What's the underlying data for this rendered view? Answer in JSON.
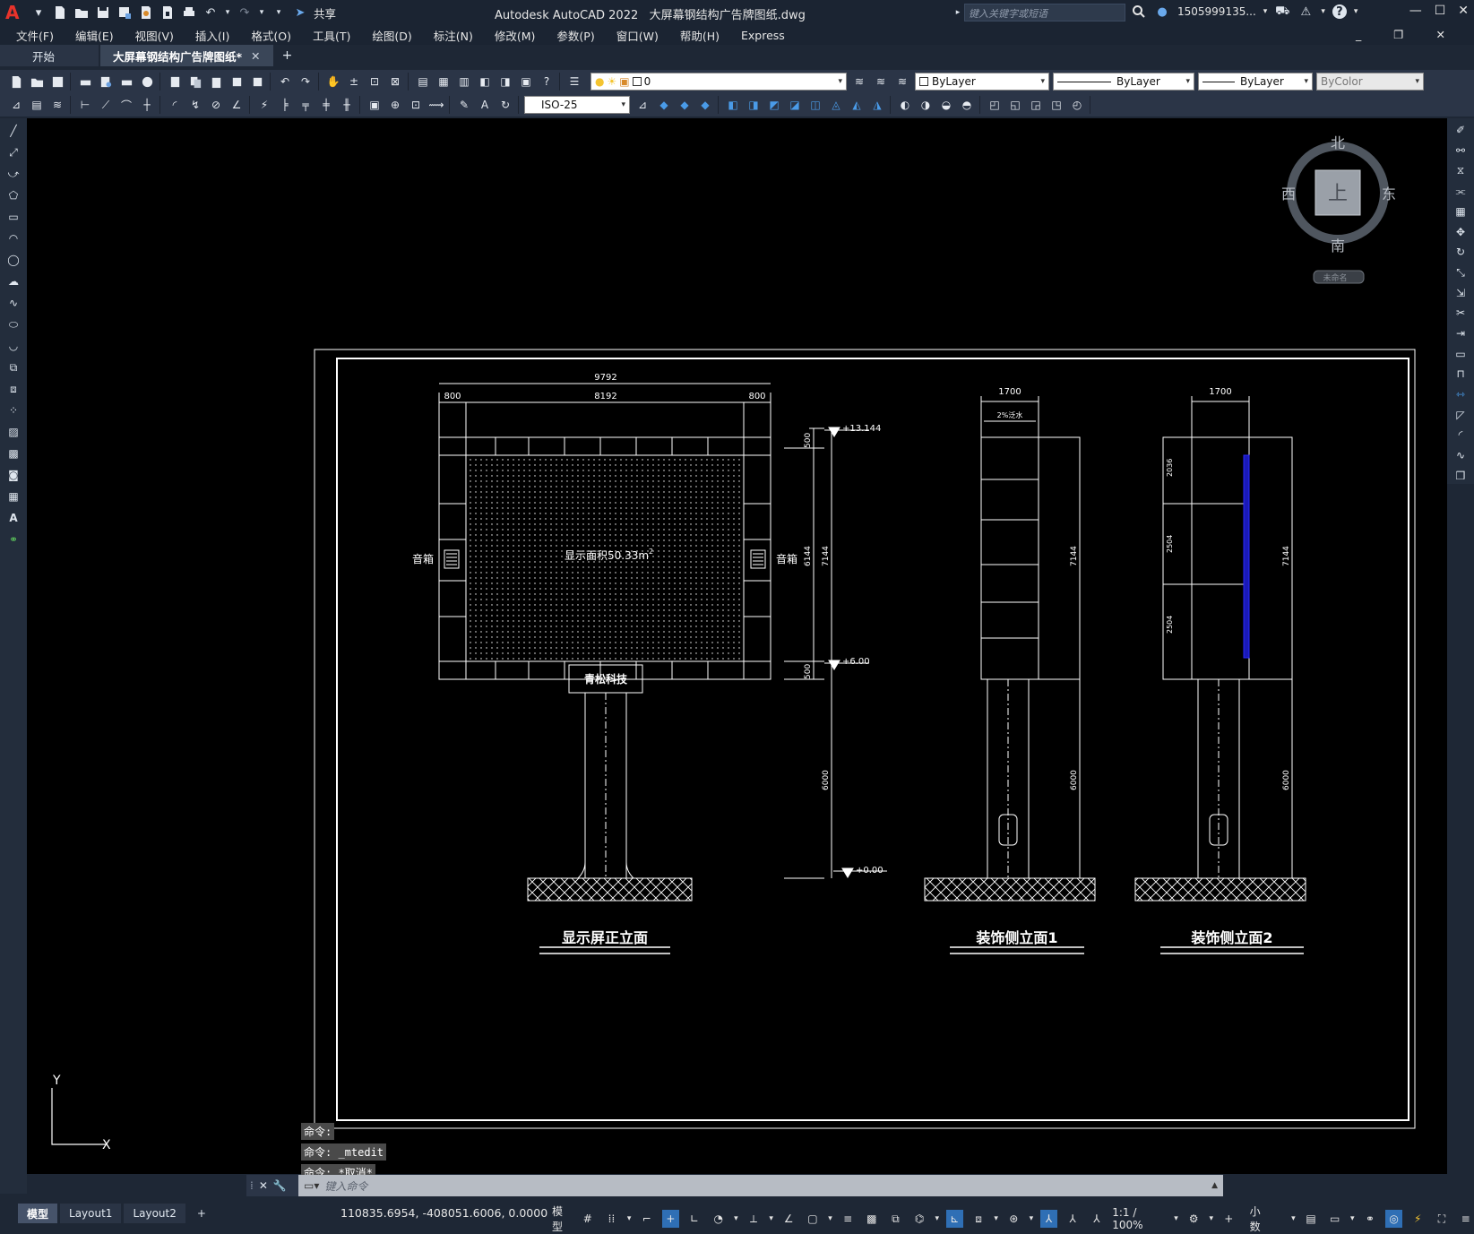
{
  "app": {
    "title": "Autodesk AutoCAD 2022",
    "file": "大屏幕钢结构广告牌图纸.dwg",
    "share": "共享",
    "search_placeholder": "键入关键字或短语",
    "user": "1505999135...",
    "help": "?"
  },
  "menu": [
    "文件(F)",
    "编辑(E)",
    "视图(V)",
    "插入(I)",
    "格式(O)",
    "工具(T)",
    "绘图(D)",
    "标注(N)",
    "修改(M)",
    "参数(P)",
    "窗口(W)",
    "帮助(H)",
    "Express"
  ],
  "tabs": {
    "start": "开始",
    "doc": "大屏幕钢结构广告牌图纸*",
    "close": "✕",
    "add": "+"
  },
  "props": {
    "layer": "0",
    "color": "ByLayer",
    "linetype": "ByLayer",
    "lineweight": "ByLayer",
    "plotstyle": "ByColor",
    "dimstyle": "ISO-25"
  },
  "viewcube": {
    "north": "北",
    "south": "南",
    "east": "东",
    "west": "西",
    "top": "上",
    "wcs": "未命名"
  },
  "drawing": {
    "front": {
      "title": "显示屏正立面",
      "dim_total": "9792",
      "dim_left": "800",
      "dim_mid": "8192",
      "dim_right": "800",
      "speaker_l": "音箱",
      "speaker_r": "音箱",
      "screen_area": "显示面积50.33m",
      "sup": "2",
      "brand": "青松科技",
      "elev_top": "+13.144",
      "elev_mid": "+6.00",
      "elev_base": "+0.00",
      "d500a": "500",
      "d6144": "6144",
      "d7144": "7144",
      "d500b": "500",
      "d6000": "6000"
    },
    "side1": {
      "title": "装饰侧立面1",
      "dim_w": "1700",
      "dim_inner": "2%泛水",
      "d7144": "7144",
      "d6000": "6000"
    },
    "side2": {
      "title": "装饰侧立面2",
      "dim_w": "1700",
      "d2036": "2036",
      "d2504a": "2504",
      "d2504b": "2504",
      "d7144": "7144",
      "d6000": "6000"
    }
  },
  "ucs": {
    "x": "X",
    "y": "Y"
  },
  "command": {
    "history": [
      "命令:",
      "命令: _mtedit",
      "命令: *取消*"
    ],
    "placeholder": "键入命令"
  },
  "layouts": [
    "模型",
    "Layout1",
    "Layout2"
  ],
  "status": {
    "coords": "110835.6954, -408051.6006, 0.0000",
    "model": "模型",
    "scale": "1:1 / 100%",
    "units": "小数"
  }
}
